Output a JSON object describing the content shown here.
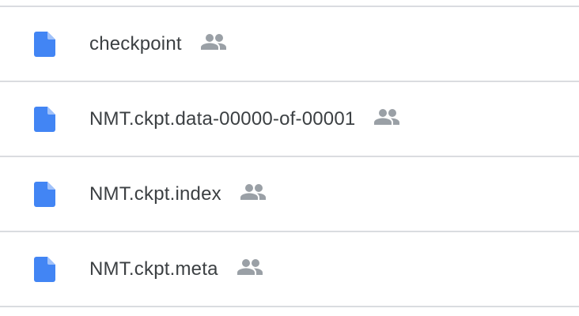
{
  "files": [
    {
      "name": "checkpoint",
      "icon": "google-docs-file-icon",
      "shared_icon": "shared-people-icon"
    },
    {
      "name": "NMT.ckpt.data-00000-of-00001",
      "icon": "google-docs-file-icon",
      "shared_icon": "shared-people-icon"
    },
    {
      "name": "NMT.ckpt.index",
      "icon": "google-docs-file-icon",
      "shared_icon": "shared-people-icon"
    },
    {
      "name": "NMT.ckpt.meta",
      "icon": "google-docs-file-icon",
      "shared_icon": "shared-people-icon"
    }
  ],
  "colors": {
    "doc_icon": "#4285f4",
    "shared_icon": "#9aa0a6",
    "text": "#3c4043",
    "divider": "#dadce0"
  }
}
